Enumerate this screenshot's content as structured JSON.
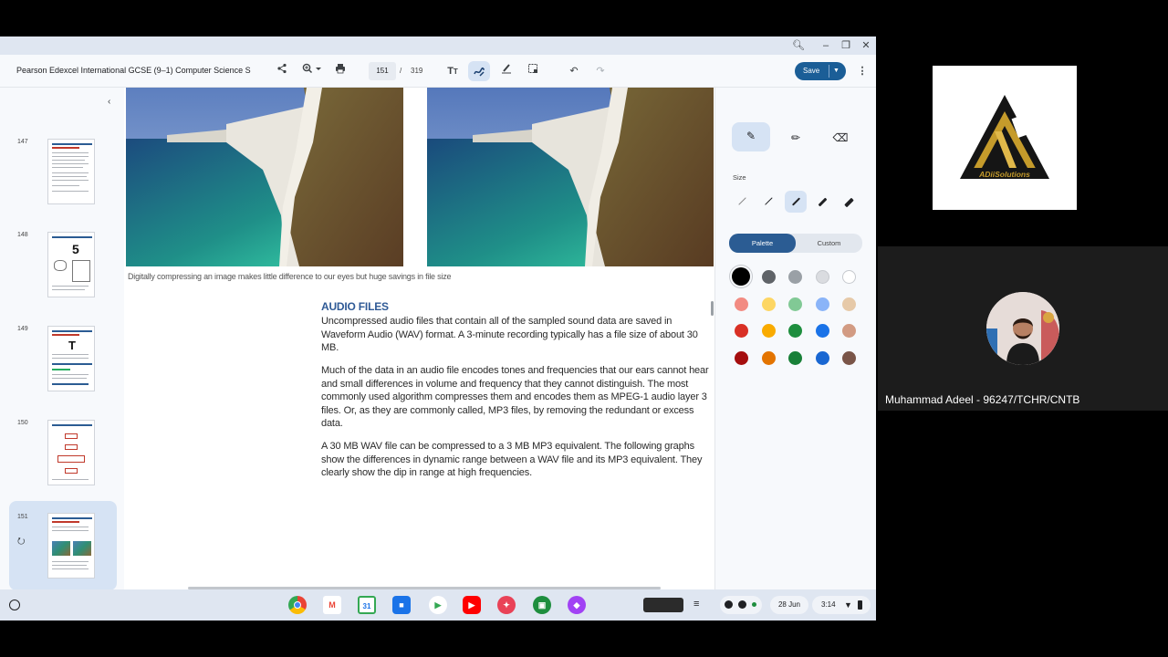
{
  "window": {
    "document_title": "Pearson Edexcel International GCSE (9–1) Computer Science S",
    "current_page": "151",
    "page_separator": "/",
    "total_pages": "319",
    "save_label": "Save"
  },
  "thumbnails": [
    {
      "page": "147"
    },
    {
      "page": "148"
    },
    {
      "page": "149"
    },
    {
      "page": "150"
    },
    {
      "page": "151"
    }
  ],
  "document": {
    "caption": "Digitally compressing an image makes little difference to our eyes but huge savings in file size",
    "heading": "AUDIO FILES",
    "paragraphs": [
      "Uncompressed audio files that contain all of the sampled sound data are saved in Waveform Audio (WAV) format. A 3-minute recording typically has a file size of about 30 MB.",
      "Much of the data in an audio file encodes tones and frequencies that our ears cannot hear and small differences in volume and frequency that they cannot distinguish. The most commonly used algorithm compresses them and encodes them as MPEG-1 audio layer 3 files. Or, as they are commonly called, MP3 files, by removing the redundant or excess data.",
      "A 30 MB WAV file can be compressed to a 3 MB MP3 equivalent. The following graphs show the differences in dynamic range between a WAV file and its MP3 equivalent. They clearly show the dip in range at high frequencies."
    ]
  },
  "annotation_panel": {
    "size_label": "Size",
    "tab_palette": "Palette",
    "tab_custom": "Custom",
    "colors": [
      [
        "#000000",
        "#5f6368",
        "#9aa0a6",
        "#dadce0",
        "#ffffff"
      ],
      [
        "#f28b82",
        "#fdd663",
        "#81c995",
        "#8ab4f8",
        "#e6c9a8"
      ],
      [
        "#d93025",
        "#f9ab00",
        "#1e8e3e",
        "#1a73e8",
        "#d29b83"
      ],
      [
        "#a50e0e",
        "#e37400",
        "#188038",
        "#1967d2",
        "#7a5548"
      ]
    ]
  },
  "shelf": {
    "date": "28 Jun",
    "time": "3:14"
  },
  "webinar": {
    "logo_text": "ADiiSolutions",
    "presenter_name": "Muhammad Adeel - 96247/TCHR/CNTB"
  }
}
